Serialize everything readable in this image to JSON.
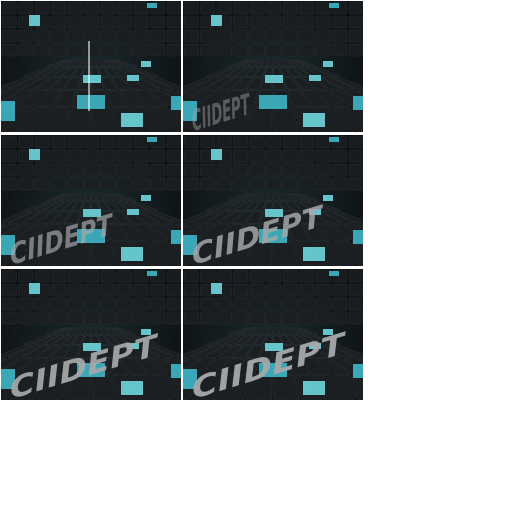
{
  "sheet": {
    "background": "#ffffff",
    "frames": [
      {
        "label": "",
        "reveal": 0.0
      },
      {
        "label": "CIIDEPT",
        "reveal": 0.15
      },
      {
        "label": "CIIDEPT",
        "reveal": 0.55
      },
      {
        "label": "CIIDEPT",
        "reveal": 0.8
      },
      {
        "label": "CIIDEPT",
        "reveal": 0.95
      },
      {
        "label": "CIIDEPT",
        "reveal": 1.0
      }
    ]
  },
  "palette": {
    "dark": "#0b0c0d",
    "tile": "#1c1f22",
    "tile_edge": "#2e3336",
    "cyan": "#3fb6c6",
    "cyan_bright": "#6fd6de",
    "text": "#a7a9ab"
  },
  "icons": [
    "3d-text-render"
  ]
}
